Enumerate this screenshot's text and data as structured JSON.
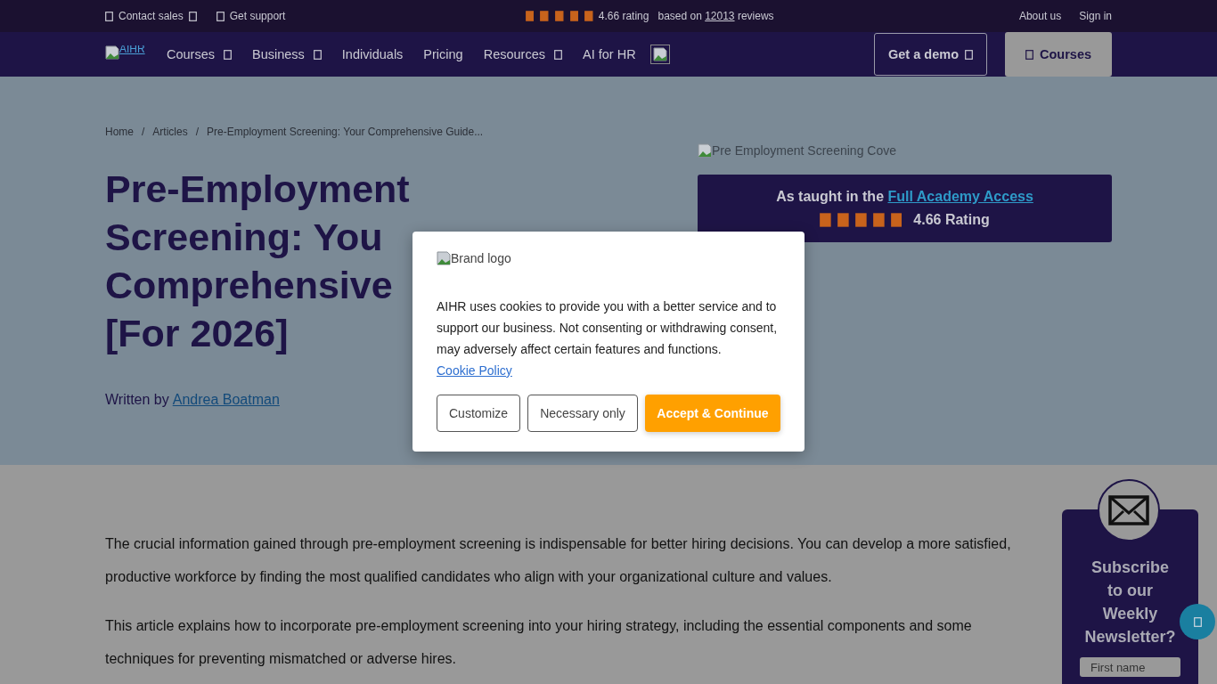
{
  "top_bar": {
    "links": [
      {
        "label": "Contact sales",
        "caret": true
      },
      {
        "label": "Get support",
        "caret": false
      }
    ],
    "rating": {
      "stars": 5,
      "score": "4.66 rating",
      "prefix": "based on",
      "count": "12013",
      "suffix": "reviews"
    },
    "right_links": [
      "About us",
      "Sign in"
    ]
  },
  "nav": {
    "logo_alt": "AIHR",
    "items": [
      {
        "label": "Courses",
        "caret": true
      },
      {
        "label": "Business",
        "caret": true
      },
      {
        "label": "Individuals",
        "caret": false
      },
      {
        "label": "Pricing",
        "caret": false
      },
      {
        "label": "Resources",
        "caret": true
      },
      {
        "label": "AI for HR",
        "caret": false
      }
    ],
    "demo_button": "Get a demo",
    "courses_button": "Courses"
  },
  "breadcrumb": {
    "separator": "/",
    "items": [
      "Home",
      "Articles",
      "Pre-Employment Screening: Your Comprehensive Guide..."
    ]
  },
  "title_lines": [
    "Pre-Employment",
    "Screening: You",
    "Comprehensive",
    "[For 2026]"
  ],
  "author": {
    "prefix": "Written by",
    "name": "Andrea Boatman"
  },
  "cover_alt": "Pre Employment Screening Cove",
  "academy": {
    "text": "As taught in the",
    "link": "Full Academy Access",
    "stars": 5,
    "rating": "4.66 Rating"
  },
  "paragraphs": [
    "The crucial information gained through pre-employment screening is indispensable for better hiring decisions. You can develop a more satisfied, productive workforce by finding the most qualified candidates who align with your organizational culture and values.",
    "This article explains how to incorporate pre-employment screening into your hiring strategy, including the essential components and some techniques for preventing mismatched or adverse hires."
  ],
  "newsletter": {
    "title": "Subscribe to our Weekly Newsletter?",
    "placeholder": "First name"
  },
  "cookie": {
    "logo_alt": "Brand logo",
    "text": "AIHR uses cookies to provide you with a better service and to support our business. Not consenting or withdrawing consent, may adversely affect certain features and functions.",
    "policy_link": "Cookie Policy",
    "buttons": [
      {
        "label": "Customize",
        "kind": "outline"
      },
      {
        "label": "Necessary only",
        "kind": "outline"
      },
      {
        "label": "Accept & Continue",
        "kind": "primary"
      }
    ]
  }
}
